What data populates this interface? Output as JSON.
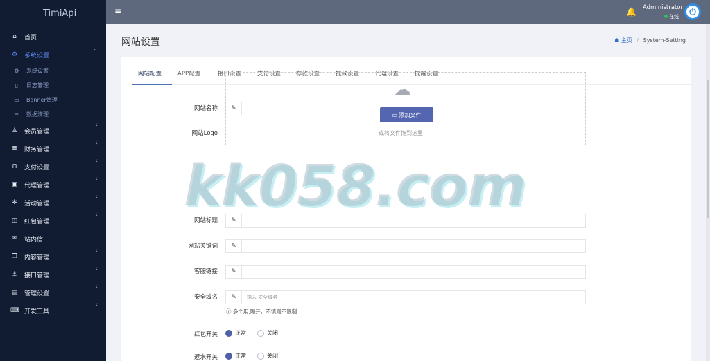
{
  "brand": "TimiApi",
  "sidebar": {
    "items": [
      {
        "label": "首页",
        "icon": "home-icon",
        "glyph": "⌂"
      },
      {
        "label": "系统设置",
        "icon": "gears-icon",
        "glyph": "⚙",
        "chevron": "⌄"
      },
      {
        "label": "会员管理",
        "icon": "user-icon",
        "glyph": "♙",
        "chevron": "‹"
      },
      {
        "label": "财务管理",
        "icon": "database-icon",
        "glyph": "≣",
        "chevron": "‹"
      },
      {
        "label": "支付设置",
        "icon": "bookmark-icon",
        "glyph": "⊓",
        "chevron": "‹"
      },
      {
        "label": "代理管理",
        "icon": "id-card-icon",
        "glyph": "▣",
        "chevron": "‹"
      },
      {
        "label": "活动管理",
        "icon": "activity-icon",
        "glyph": "✻",
        "chevron": "‹"
      },
      {
        "label": "红包管理",
        "icon": "clone-icon",
        "glyph": "◫",
        "chevron": "‹"
      },
      {
        "label": "站内信",
        "icon": "envelope-icon",
        "glyph": "✉"
      },
      {
        "label": "内容管理",
        "icon": "copy-icon",
        "glyph": "❐",
        "chevron": "‹"
      },
      {
        "label": "接口管理",
        "icon": "anchor-icon",
        "glyph": "⚓",
        "chevron": "‹"
      },
      {
        "label": "管理设置",
        "icon": "address-card-icon",
        "glyph": "▤",
        "chevron": "‹"
      },
      {
        "label": "开发工具",
        "icon": "keyboard-icon",
        "glyph": "⌨",
        "chevron": "‹"
      }
    ],
    "subitems": [
      {
        "label": "系统设置",
        "icon": "gear-icon",
        "glyph": "⚙"
      },
      {
        "label": "日志管理",
        "icon": "file-icon",
        "glyph": "▯"
      },
      {
        "label": "Banner管理",
        "icon": "image-icon",
        "glyph": "▭"
      },
      {
        "label": "数据清理",
        "icon": "scissors-icon",
        "glyph": "✂"
      }
    ]
  },
  "topbar": {
    "menu_glyph": "≡",
    "bell_glyph": "🔔",
    "user_name": "Administrator",
    "user_status": "在线",
    "power_glyph": "⏻"
  },
  "page": {
    "title": "网站设置",
    "breadcrumb_home": "主页",
    "breadcrumb_sep": "/",
    "breadcrumb_current": "System-Setting"
  },
  "tabs": [
    "网站配置",
    "APP配置",
    "接口设置",
    "支付设置",
    "存款设置",
    "提款设置",
    "代理设置",
    "提醒设置"
  ],
  "form": {
    "site_name_label": "网站名称",
    "site_name_value": "",
    "logo_label": "网站Logo",
    "upload_button": "添加文件",
    "upload_hint": "或将文件拖到这里",
    "site_title_label": "网站标题",
    "site_title_value": "",
    "site_keywords_label": "网站关键词",
    "site_keywords_value": ",",
    "service_link_label": "客服链接",
    "service_link_value": "",
    "safe_domain_label": "安全域名",
    "safe_domain_placeholder": "输入 安全域名",
    "safe_domain_help": "多个用,隔开，不填则不限制",
    "redpacket_label": "红包开关",
    "rebate_label": "返水开关",
    "opt_on": "正常",
    "opt_off": "关闭"
  },
  "watermark": "kk058.com"
}
